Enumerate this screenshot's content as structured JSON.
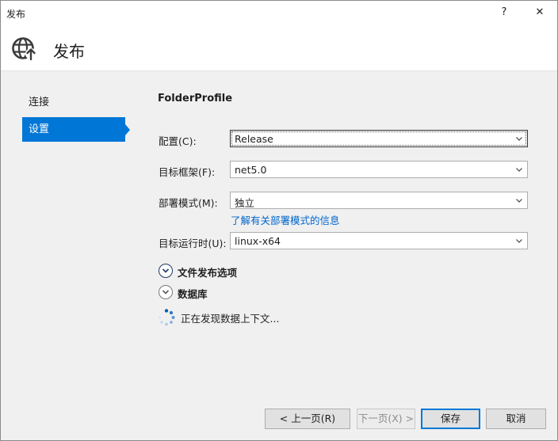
{
  "window": {
    "title": "发布",
    "help_glyph": "?",
    "close_glyph": "✕"
  },
  "header": {
    "title": "发布",
    "icon": "globe-publish-icon"
  },
  "sidebar": {
    "items": [
      {
        "label": "连接",
        "active": false
      },
      {
        "label": "设置",
        "active": true
      }
    ]
  },
  "settings": {
    "profile_name": "FolderProfile",
    "configuration": {
      "label": "配置(C):",
      "value": "Release"
    },
    "target_framework": {
      "label": "目标框架(F):",
      "value": "net5.0"
    },
    "deployment_mode": {
      "label": "部署模式(M):",
      "value": "独立"
    },
    "deployment_link": "了解有关部署模式的信息",
    "target_runtime": {
      "label": "目标运行时(U):",
      "value": "linux-x64"
    },
    "file_publish_options": "文件发布选项",
    "database": "数据库",
    "status_text": "正在发现数据上下文..."
  },
  "footer": {
    "prev_label": "< 上一页(R)",
    "next_label": "下一页(X) >",
    "save_label": "保存",
    "cancel_label": "取消"
  },
  "colors": {
    "accent": "#0076d7",
    "link": "#0066cc"
  }
}
